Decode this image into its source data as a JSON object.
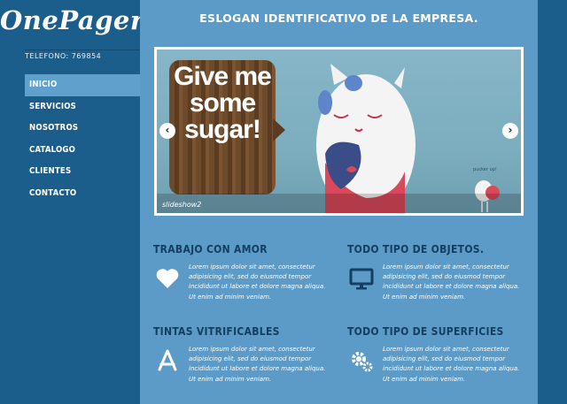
{
  "brand": {
    "logo": "OnePager",
    "phone": "TELEFONO: 769854"
  },
  "nav": {
    "items": [
      {
        "label": "INICIO",
        "active": true
      },
      {
        "label": "SERVICIOS"
      },
      {
        "label": "NOSOTROS"
      },
      {
        "label": "CATALOGO"
      },
      {
        "label": "CLIENTES"
      },
      {
        "label": "CONTACTO"
      }
    ]
  },
  "header": {
    "slogan": "ESLOGAN IDENTIFICATIVO DE LA EMPRESA."
  },
  "slider": {
    "sign_text": "Give me some sugar!",
    "tag_text": "pucker up!",
    "caption": "slideshow2",
    "prev_icon": "chevron-left-icon",
    "next_icon": "chevron-right-icon"
  },
  "features": [
    {
      "title": "TRABAJO CON AMOR",
      "icon": "heart-icon",
      "text": "Lorem ipsum dolor sit amet, consectetur adipisicing elit, sed do eiusmod tempor incididunt ut labore et dolore magna aliqua. Ut enim ad minim veniam."
    },
    {
      "title": "TODO TIPO DE OBJETOS.",
      "icon": "monitor-icon",
      "text": "Lorem ipsum dolor sit amet, consectetur adipisicing elit, sed do eiusmod tempor incididunt ut labore et dolore magna aliqua. Ut enim ad minim veniam."
    },
    {
      "title": "TINTAS VITRIFICABLES",
      "icon": "app-store-icon",
      "text": "Lorem ipsum dolor sit amet, consectetur adipisicing elit, sed do eiusmod tempor incididunt ut labore et dolore magna aliqua. Ut enim ad minim veniam."
    },
    {
      "title": "TODO TIPO DE SUPERFICIES",
      "icon": "gears-icon",
      "text": "Lorem ipsum dolor sit amet, consectetur adipisicing elit, sed do eiusmod tempor incididunt ut labore et dolore magna aliqua. Ut enim ad minim veniam."
    }
  ],
  "colors": {
    "sidebar": "#1b5d8b",
    "main": "#5c9bc7",
    "active_nav": "#5fa0cc",
    "heading": "#143e63"
  }
}
